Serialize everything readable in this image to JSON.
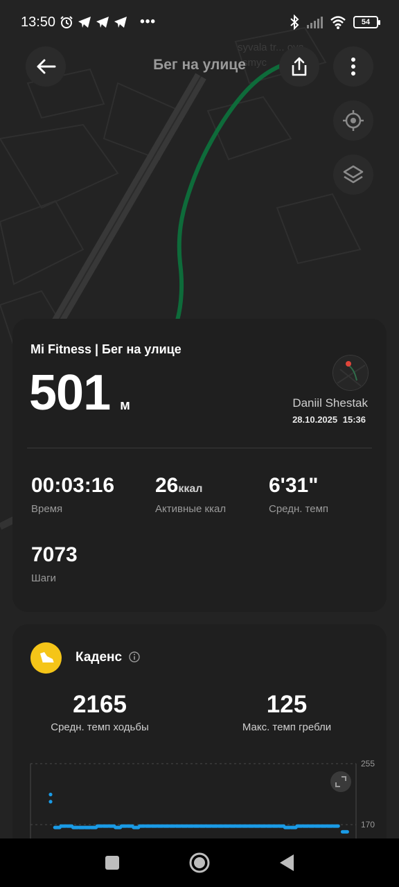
{
  "status": {
    "time": "13:50",
    "battery": "54"
  },
  "map": {
    "street_label": "syvala tr... ova",
    "street_label_2": "smyc"
  },
  "header": {
    "title": "Бег на улице"
  },
  "summary": {
    "title": "Mi Fitness | Бег на улице",
    "distance_value": "501",
    "distance_unit": "м",
    "user_name": "Daniil Shestak",
    "datetime": "28.10.2025 15:36",
    "stats": [
      {
        "value": "00:03:16",
        "label": "Время"
      },
      {
        "value": "26",
        "unit": "ккал",
        "label": "Активные ккал"
      },
      {
        "value": "6'31\"",
        "label": "Средн. темп"
      },
      {
        "value": "7073",
        "label": "Шаги"
      }
    ]
  },
  "cadence": {
    "title": "Каденс",
    "stats": [
      {
        "value": "2165",
        "label": "Средн. темп ходьбы"
      },
      {
        "value": "125",
        "label": "Макс. темп гребли"
      }
    ]
  },
  "colors": {
    "accent_cadence": "#f5c518",
    "chart_series": "#1a9be6",
    "route": "#0e6b3a"
  },
  "chart_data": {
    "type": "scatter",
    "y_ticks": [
      "255",
      "170"
    ],
    "ylim": [
      170,
      255
    ],
    "series": [
      {
        "values": [
          [
            0.0,
            212
          ],
          [
            0.0,
            202
          ],
          [
            0.02,
            166
          ],
          [
            0.04,
            168
          ],
          [
            0.06,
            168
          ],
          [
            0.08,
            166
          ],
          [
            0.1,
            166
          ],
          [
            0.12,
            166
          ],
          [
            0.14,
            166
          ],
          [
            0.16,
            168
          ],
          [
            0.18,
            168
          ],
          [
            0.2,
            168
          ],
          [
            0.22,
            166
          ],
          [
            0.24,
            168
          ],
          [
            0.26,
            168
          ],
          [
            0.28,
            166
          ],
          [
            0.3,
            168
          ],
          [
            0.32,
            168
          ],
          [
            0.34,
            168
          ],
          [
            0.36,
            168
          ],
          [
            0.38,
            168
          ],
          [
            0.4,
            168
          ],
          [
            0.42,
            168
          ],
          [
            0.44,
            168
          ],
          [
            0.46,
            168
          ],
          [
            0.48,
            168
          ],
          [
            0.5,
            168
          ],
          [
            0.52,
            168
          ],
          [
            0.54,
            168
          ],
          [
            0.56,
            168
          ],
          [
            0.58,
            168
          ],
          [
            0.6,
            168
          ],
          [
            0.62,
            168
          ],
          [
            0.64,
            168
          ],
          [
            0.66,
            168
          ],
          [
            0.68,
            168
          ],
          [
            0.7,
            168
          ],
          [
            0.72,
            168
          ],
          [
            0.74,
            168
          ],
          [
            0.76,
            168
          ],
          [
            0.78,
            166
          ],
          [
            0.8,
            166
          ],
          [
            0.82,
            168
          ],
          [
            0.84,
            168
          ],
          [
            0.86,
            168
          ],
          [
            0.88,
            168
          ],
          [
            0.9,
            168
          ],
          [
            0.92,
            168
          ],
          [
            0.94,
            168
          ],
          [
            0.97,
            160
          ]
        ]
      }
    ]
  }
}
